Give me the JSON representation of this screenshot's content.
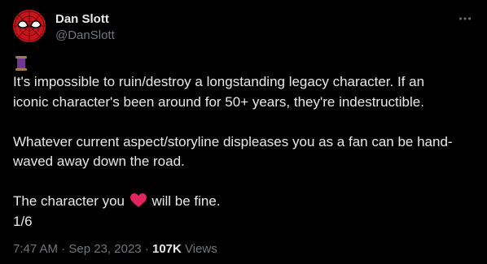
{
  "author": {
    "display_name": "Dan Slott",
    "handle": "@DanSlott",
    "avatar_icon": "spider-man-mask-icon"
  },
  "more_icon": "more-horizontal-icon",
  "thread_icon": "thread-spool-icon",
  "tweet": {
    "line1": "It's impossible to ruin/destroy a longstanding legacy character. If an",
    "line2": "iconic character's been around for 50+ years, they're indestructible.",
    "line3": "Whatever current aspect/storyline displeases you as a fan can be hand-",
    "line4": "waved away down the road.",
    "line5_before": "The character you ",
    "line5_emoji": "red-heart-icon",
    "line5_after": " will be fine.",
    "line6": "1/6"
  },
  "meta": {
    "time": "7:47 AM",
    "separator1": " · ",
    "date": "Sep 23, 2023",
    "separator2": " · ",
    "views_count": "107K",
    "views_label": " Views"
  },
  "colors": {
    "background": "#000000",
    "text": "#e7e9ea",
    "secondary": "#71767b",
    "heart": "#e0245e",
    "avatar": "#c8141c"
  }
}
